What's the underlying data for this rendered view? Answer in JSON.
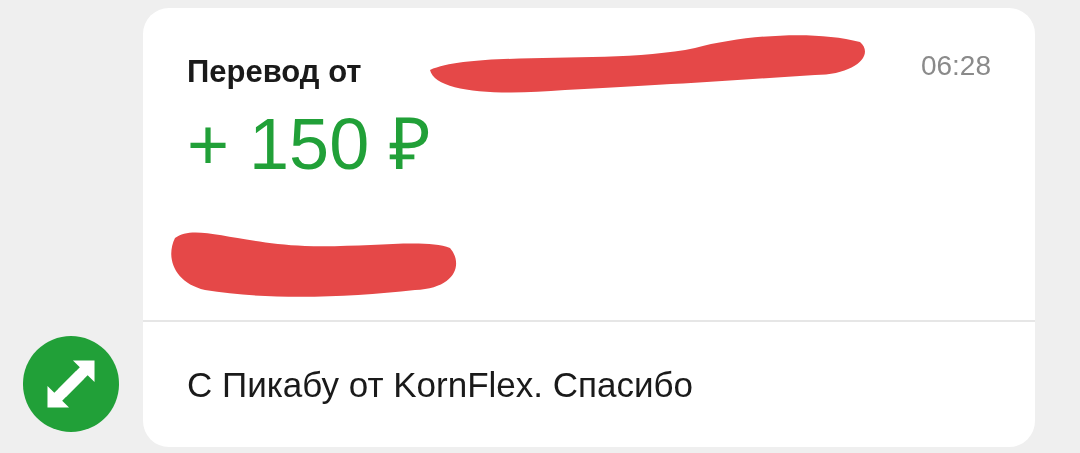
{
  "message": {
    "title": "Перевод от",
    "time": "06:28",
    "amount": "+ 150 ₽",
    "comment": "С Пикабу от KornFlex. Спасибо"
  }
}
